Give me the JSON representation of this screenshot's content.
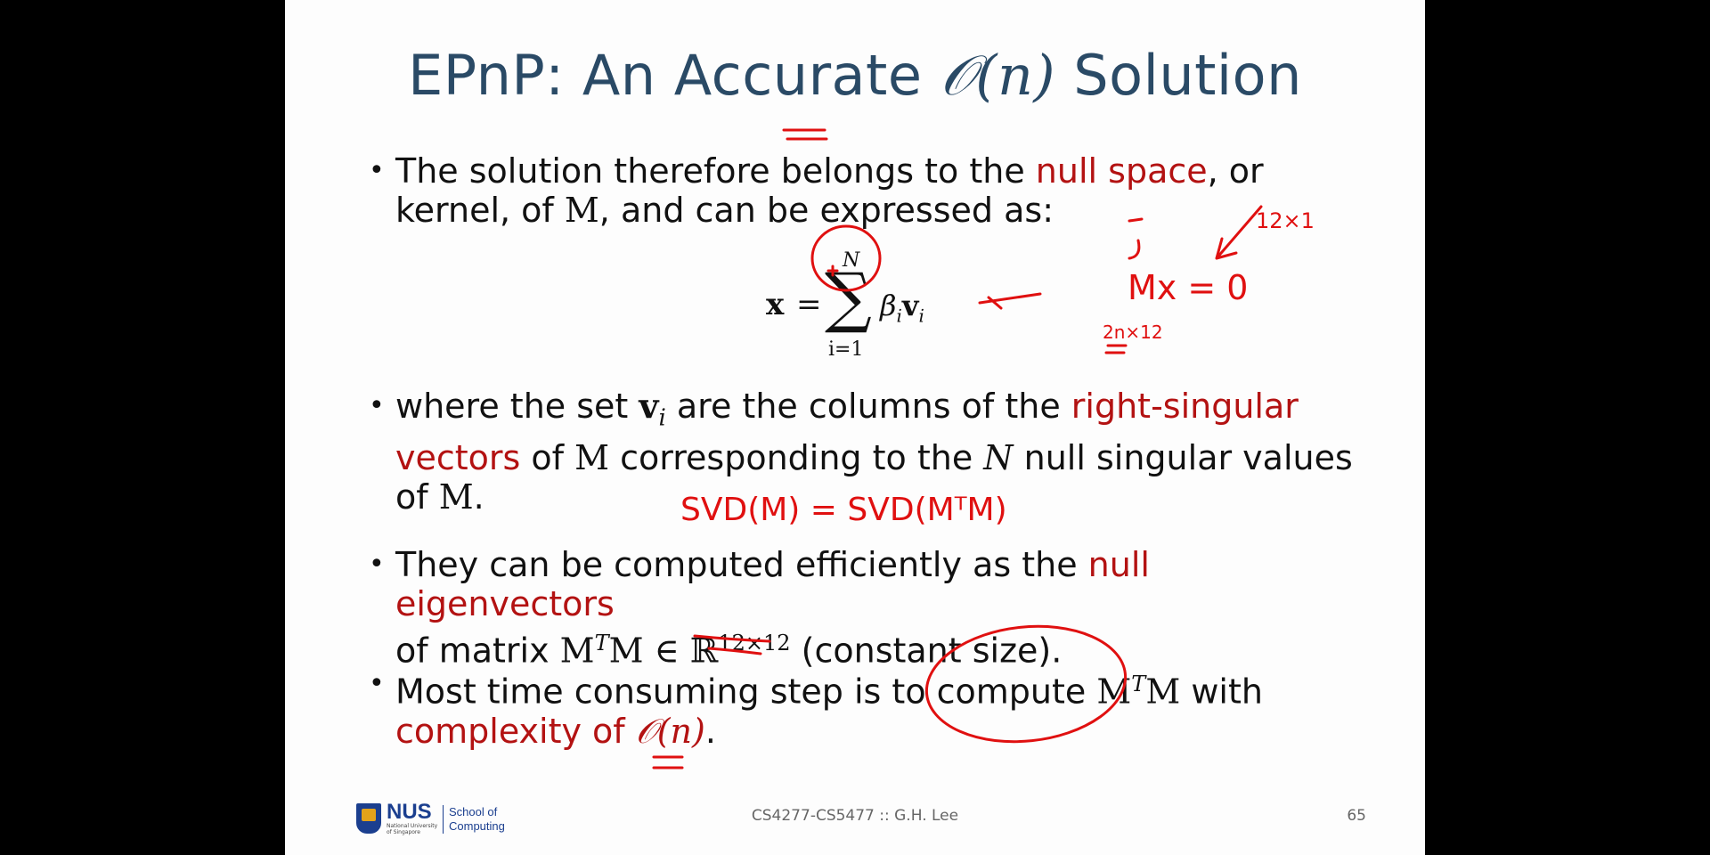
{
  "slide": {
    "title_text": "EPnP: An Accurate ",
    "title_math": "𝒪(n)",
    "title_tail": " Solution",
    "bullet1": {
      "a": "The solution therefore belongs to the ",
      "hl": "null space",
      "b": ", or",
      "c": "kernel, of ",
      "m": "M",
      "d": ", and can be expressed as:"
    },
    "equation": {
      "lhs": "x",
      "eq": "=",
      "sum": "∑",
      "upper": "N",
      "lower": "i=1",
      "beta": "β",
      "beta_sub": "i",
      "v": "v",
      "v_sub": "i"
    },
    "bullet2": {
      "a": "where the set ",
      "v": "v",
      "v_sub": "i",
      "b": " are the columns of the ",
      "hl1": "right-singular",
      "hl2": "vectors",
      "c": " of ",
      "m1": "M",
      "d": " corresponding to the ",
      "n": "N",
      "e": " null singular values",
      "f": "of ",
      "m2": "M",
      "g": "."
    },
    "bullet3": {
      "a": "They can be computed efficiently as the ",
      "hl": "null eigenvectors",
      "b": "of matrix ",
      "mt": "M",
      "t": "T",
      "m": "M ∈ ℝ",
      "sup": "12×12",
      "c": " (constant size)."
    },
    "bullet4": {
      "a": "Most time consuming step is to compute ",
      "mt": "M",
      "t": "T",
      "m": "M",
      "b": " with",
      "hl": "complexity of ",
      "hl_math": "𝒪(n)",
      "c": "."
    },
    "footer": {
      "nus": "NUS",
      "university": "National University of Singapore",
      "school": "School of Computing",
      "course": "CS4277-CS5477 :: G.H. Lee",
      "page": "65"
    },
    "annotations": {
      "size1": "12×1",
      "eq": "Mx = 0",
      "size2": "2n×12",
      "svd": "SVD(M) = SVD(MᵀM)"
    },
    "colors": {
      "title": "#2a4a66",
      "highlight": "#b31212",
      "ink": "#e01010"
    }
  }
}
